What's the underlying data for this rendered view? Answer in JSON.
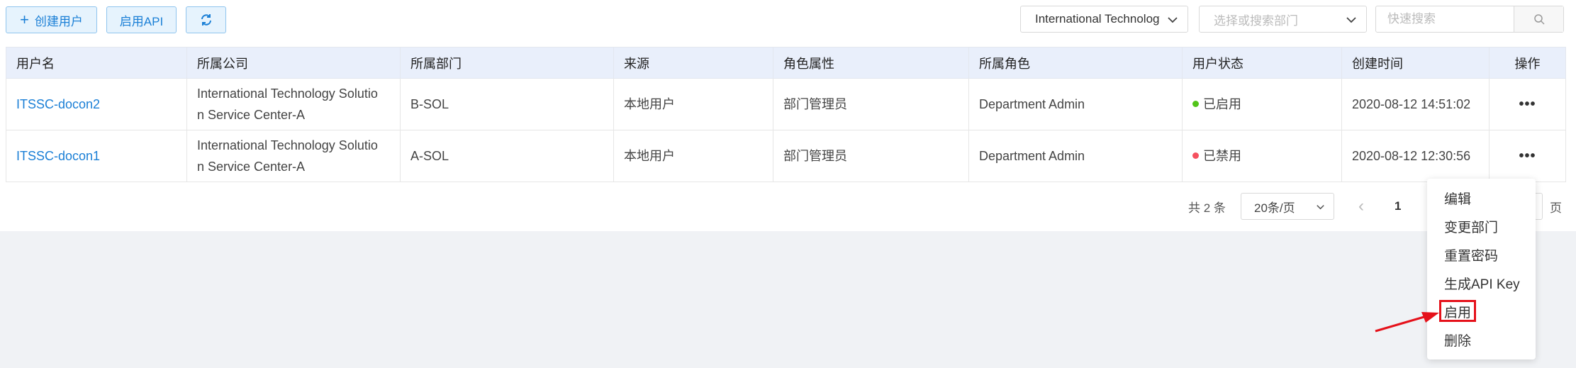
{
  "toolbar": {
    "create_user": "创建用户",
    "enable_api": "启用API",
    "company_select": "International Technology Solution Service Center-A",
    "dept_placeholder": "选择或搜索部门",
    "search_placeholder": "快速搜索"
  },
  "table": {
    "headers": [
      "用户名",
      "所属公司",
      "所属部门",
      "来源",
      "角色属性",
      "所属角色",
      "用户状态",
      "创建时间",
      "操作"
    ],
    "rows": [
      {
        "username": "ITSSC-docon2",
        "company_line1": "International Technology Solutio",
        "company_line2": "n Service Center-A",
        "dept": "B-SOL",
        "source": "本地用户",
        "role_attr": "部门管理员",
        "role": "Department Admin",
        "status": "已启用",
        "created": "2020-08-12 14:51:02",
        "ops": "•••"
      },
      {
        "username": "ITSSC-docon1",
        "company_line1": "International Technology Solutio",
        "company_line2": "n Service Center-A",
        "dept": "A-SOL",
        "source": "本地用户",
        "role_attr": "部门管理员",
        "role": "Department Admin",
        "status": "已禁用",
        "created": "2020-08-12 12:30:56",
        "ops": "•••"
      }
    ]
  },
  "pagination": {
    "total": "共 2 条",
    "page_size": "20条/页",
    "prev": "‹",
    "current_page": "1",
    "page_suffix": "页"
  },
  "menu": {
    "items": [
      "编辑",
      "变更部门",
      "重置密码",
      "生成API Key",
      "启用",
      "删除"
    ]
  },
  "colors": {
    "accent": "#1a7fd6",
    "status_enabled": "#52c41a",
    "status_disabled": "#f5515f",
    "highlight": "#e5111a"
  }
}
